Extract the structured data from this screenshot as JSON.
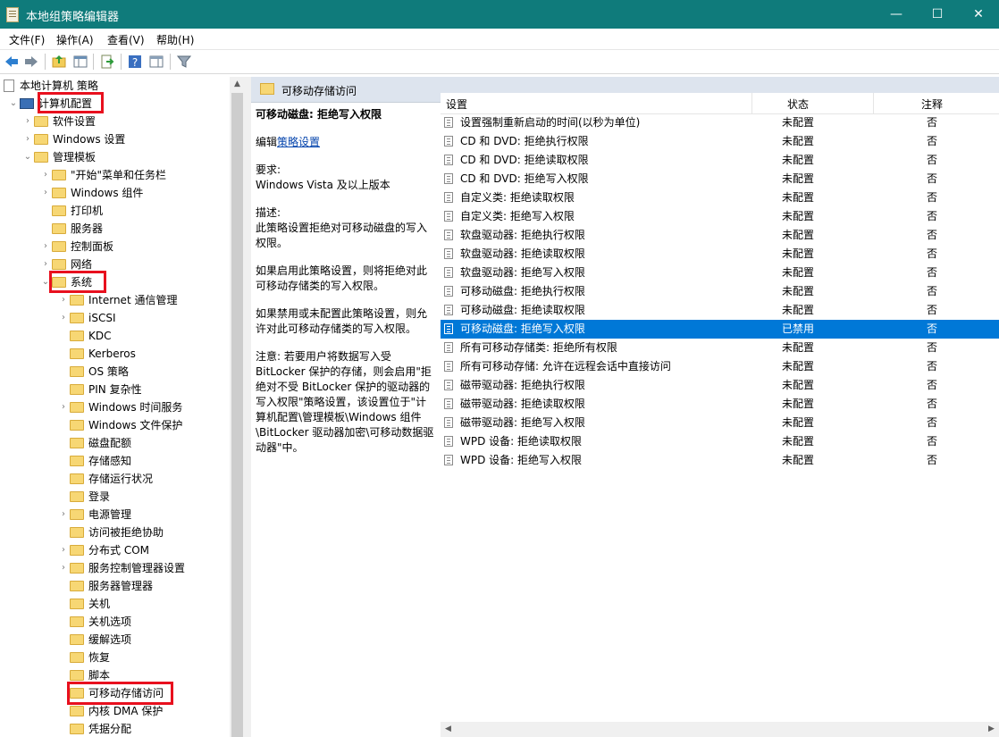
{
  "window": {
    "title": "本地组策略编辑器",
    "minimize": "—",
    "maximize": "☐",
    "close": "✕"
  },
  "menu": [
    "文件(F)",
    "操作(A)",
    "查看(V)",
    "帮助(H)"
  ],
  "toolbar": [
    "back-icon",
    "forward-icon",
    "up-folder-icon",
    "show-hide-tree-icon",
    "export-list-icon",
    "help-icon",
    "properties-pane-icon",
    "filter-icon"
  ],
  "tree": [
    {
      "label": "本地计算机 策略",
      "level": 0,
      "toggle": "",
      "icon": "policy"
    },
    {
      "label": "计算机配置",
      "level": 0,
      "toggle": "⌄",
      "icon": "computer"
    },
    {
      "label": "软件设置",
      "level": 1,
      "toggle": "›",
      "icon": "folder"
    },
    {
      "label": "Windows 设置",
      "level": 1,
      "toggle": "›",
      "icon": "folder"
    },
    {
      "label": "管理模板",
      "level": 1,
      "toggle": "⌄",
      "icon": "folder"
    },
    {
      "label": "\"开始\"菜单和任务栏",
      "level": 2,
      "toggle": "›",
      "icon": "folder"
    },
    {
      "label": "Windows 组件",
      "level": 2,
      "toggle": "›",
      "icon": "folder"
    },
    {
      "label": "打印机",
      "level": 2,
      "toggle": "",
      "icon": "folder"
    },
    {
      "label": "服务器",
      "level": 2,
      "toggle": "",
      "icon": "folder"
    },
    {
      "label": "控制面板",
      "level": 2,
      "toggle": "›",
      "icon": "folder"
    },
    {
      "label": "网络",
      "level": 2,
      "toggle": "›",
      "icon": "folder"
    },
    {
      "label": "系统",
      "level": 2,
      "toggle": "⌄",
      "icon": "folder"
    },
    {
      "label": "Internet 通信管理",
      "level": 3,
      "toggle": "›",
      "icon": "folder"
    },
    {
      "label": "iSCSI",
      "level": 3,
      "toggle": "›",
      "icon": "folder"
    },
    {
      "label": "KDC",
      "level": 3,
      "toggle": "",
      "icon": "folder"
    },
    {
      "label": "Kerberos",
      "level": 3,
      "toggle": "",
      "icon": "folder"
    },
    {
      "label": "OS 策略",
      "level": 3,
      "toggle": "",
      "icon": "folder"
    },
    {
      "label": "PIN 复杂性",
      "level": 3,
      "toggle": "",
      "icon": "folder"
    },
    {
      "label": "Windows 时间服务",
      "level": 3,
      "toggle": "›",
      "icon": "folder"
    },
    {
      "label": "Windows 文件保护",
      "level": 3,
      "toggle": "",
      "icon": "folder"
    },
    {
      "label": "磁盘配额",
      "level": 3,
      "toggle": "",
      "icon": "folder"
    },
    {
      "label": "存储感知",
      "level": 3,
      "toggle": "",
      "icon": "folder"
    },
    {
      "label": "存储运行状况",
      "level": 3,
      "toggle": "",
      "icon": "folder"
    },
    {
      "label": "登录",
      "level": 3,
      "toggle": "",
      "icon": "folder"
    },
    {
      "label": "电源管理",
      "level": 3,
      "toggle": "›",
      "icon": "folder"
    },
    {
      "label": "访问被拒绝协助",
      "level": 3,
      "toggle": "",
      "icon": "folder"
    },
    {
      "label": "分布式 COM",
      "level": 3,
      "toggle": "›",
      "icon": "folder"
    },
    {
      "label": "服务控制管理器设置",
      "level": 3,
      "toggle": "›",
      "icon": "folder"
    },
    {
      "label": "服务器管理器",
      "level": 3,
      "toggle": "",
      "icon": "folder"
    },
    {
      "label": "关机",
      "level": 3,
      "toggle": "",
      "icon": "folder"
    },
    {
      "label": "关机选项",
      "level": 3,
      "toggle": "",
      "icon": "folder"
    },
    {
      "label": "缓解选项",
      "level": 3,
      "toggle": "",
      "icon": "folder"
    },
    {
      "label": "恢复",
      "level": 3,
      "toggle": "",
      "icon": "folder"
    },
    {
      "label": "脚本",
      "level": 3,
      "toggle": "",
      "icon": "folder"
    },
    {
      "label": "可移动存储访问",
      "level": 3,
      "toggle": "",
      "icon": "folder-open"
    },
    {
      "label": "内核 DMA 保护",
      "level": 3,
      "toggle": "",
      "icon": "folder"
    },
    {
      "label": "凭据分配",
      "level": 3,
      "toggle": "",
      "icon": "folder"
    }
  ],
  "right_header": "可移动存储访问",
  "description": {
    "title": "可移动磁盘: 拒绝写入权限",
    "edit_prefix": "编辑",
    "edit_link": "策略设置",
    "requirement_label": "要求:",
    "requirement": "Windows Vista 及以上版本",
    "desc_label": "描述:",
    "desc": "此策略设置拒绝对可移动磁盘的写入权限。",
    "p1": "如果启用此策略设置，则将拒绝对此可移动存储类的写入权限。",
    "p2": "如果禁用或未配置此策略设置，则允许对此可移动存储类的写入权限。",
    "p3": "注意: 若要用户将数据写入受 BitLocker 保护的存储，则会启用\"拒绝对不受 BitLocker 保护的驱动器的写入权限\"策略设置，该设置位于\"计算机配置\\管理模板\\Windows 组件\\BitLocker 驱动器加密\\可移动数据驱动器\"中。"
  },
  "columns": {
    "setting": "设置",
    "state": "状态",
    "comment": "注释"
  },
  "rows": [
    {
      "setting": "设置强制重新启动的时间(以秒为单位)",
      "state": "未配置",
      "comment": "否"
    },
    {
      "setting": "CD 和 DVD: 拒绝执行权限",
      "state": "未配置",
      "comment": "否"
    },
    {
      "setting": "CD 和 DVD: 拒绝读取权限",
      "state": "未配置",
      "comment": "否"
    },
    {
      "setting": "CD 和 DVD: 拒绝写入权限",
      "state": "未配置",
      "comment": "否"
    },
    {
      "setting": "自定义类: 拒绝读取权限",
      "state": "未配置",
      "comment": "否"
    },
    {
      "setting": "自定义类: 拒绝写入权限",
      "state": "未配置",
      "comment": "否"
    },
    {
      "setting": "软盘驱动器: 拒绝执行权限",
      "state": "未配置",
      "comment": "否"
    },
    {
      "setting": "软盘驱动器: 拒绝读取权限",
      "state": "未配置",
      "comment": "否"
    },
    {
      "setting": "软盘驱动器: 拒绝写入权限",
      "state": "未配置",
      "comment": "否"
    },
    {
      "setting": "可移动磁盘: 拒绝执行权限",
      "state": "未配置",
      "comment": "否"
    },
    {
      "setting": "可移动磁盘: 拒绝读取权限",
      "state": "未配置",
      "comment": "否"
    },
    {
      "setting": "可移动磁盘: 拒绝写入权限",
      "state": "已禁用",
      "comment": "否",
      "selected": true
    },
    {
      "setting": "所有可移动存储类: 拒绝所有权限",
      "state": "未配置",
      "comment": "否"
    },
    {
      "setting": "所有可移动存储: 允许在远程会话中直接访问",
      "state": "未配置",
      "comment": "否"
    },
    {
      "setting": "磁带驱动器: 拒绝执行权限",
      "state": "未配置",
      "comment": "否"
    },
    {
      "setting": "磁带驱动器: 拒绝读取权限",
      "state": "未配置",
      "comment": "否"
    },
    {
      "setting": "磁带驱动器: 拒绝写入权限",
      "state": "未配置",
      "comment": "否"
    },
    {
      "setting": "WPD 设备: 拒绝读取权限",
      "state": "未配置",
      "comment": "否"
    },
    {
      "setting": "WPD 设备: 拒绝写入权限",
      "state": "未配置",
      "comment": "否"
    }
  ],
  "highlight_color": "#e8101e",
  "selection_color": "#0078d7"
}
